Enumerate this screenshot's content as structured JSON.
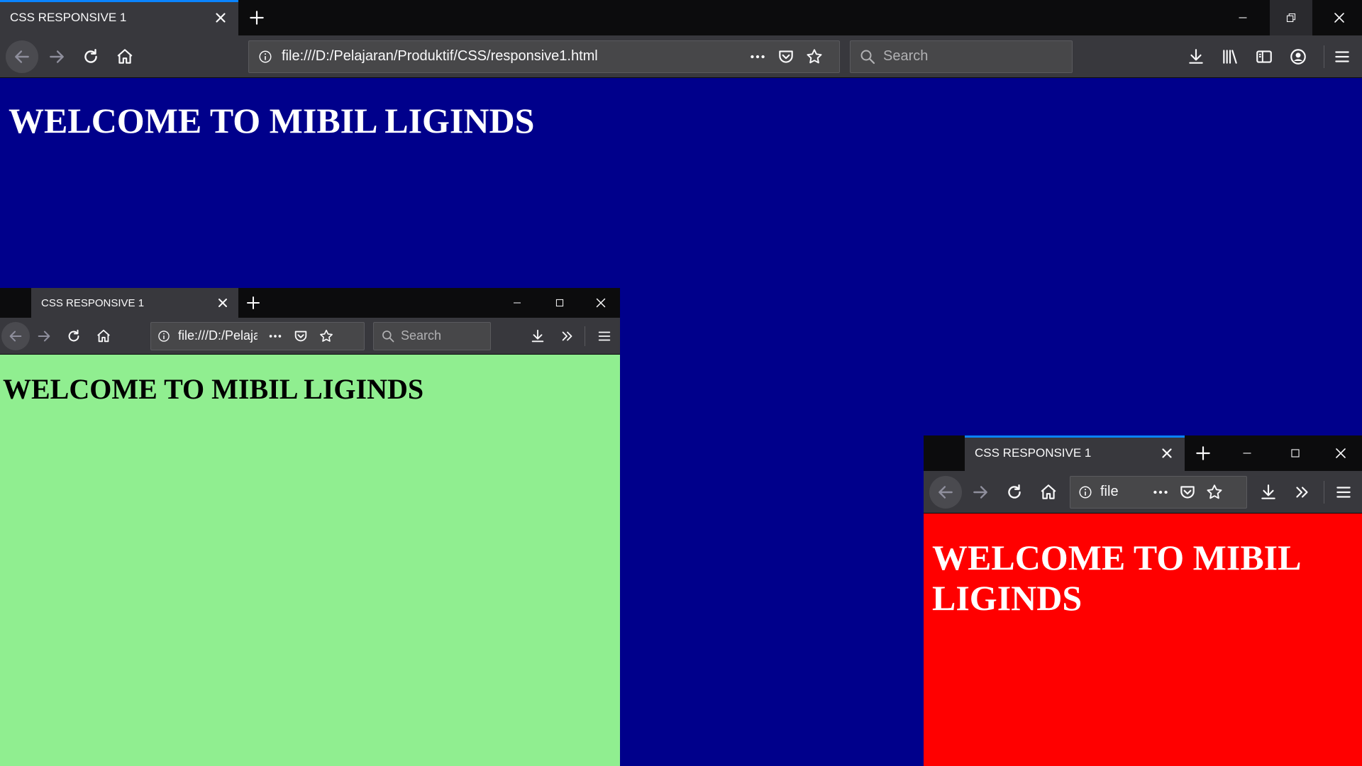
{
  "tab_title": "CSS RESPONSIVE 1",
  "url_full": "file:///D:/Pelajaran/Produktif/CSS/responsive1.html",
  "url_medium": "file:///D:/Pelaja",
  "url_small": "file",
  "search_placeholder": "Search",
  "heading": "WELCOME TO MIBIL LIGINDS",
  "colors": {
    "large_bg": "#00008b",
    "large_text": "#ffffff",
    "medium_bg": "#90ee90",
    "medium_text": "#000000",
    "small_bg": "#ff0000",
    "small_text": "#ffffff",
    "chrome_dark": "#0c0c0d",
    "chrome_toolbar": "#38383d",
    "tab_accent": "#0a84ff"
  },
  "icons": [
    "back-icon",
    "forward-icon",
    "reload-icon",
    "home-icon",
    "info-icon",
    "page-actions-icon",
    "pocket-icon",
    "bookmark-star-icon",
    "search-icon",
    "download-icon",
    "library-icon",
    "sidebar-icon",
    "account-icon",
    "menu-icon",
    "overflow-icon",
    "minimize-icon",
    "maximize-icon",
    "restore-icon",
    "close-icon",
    "new-tab-icon"
  ]
}
